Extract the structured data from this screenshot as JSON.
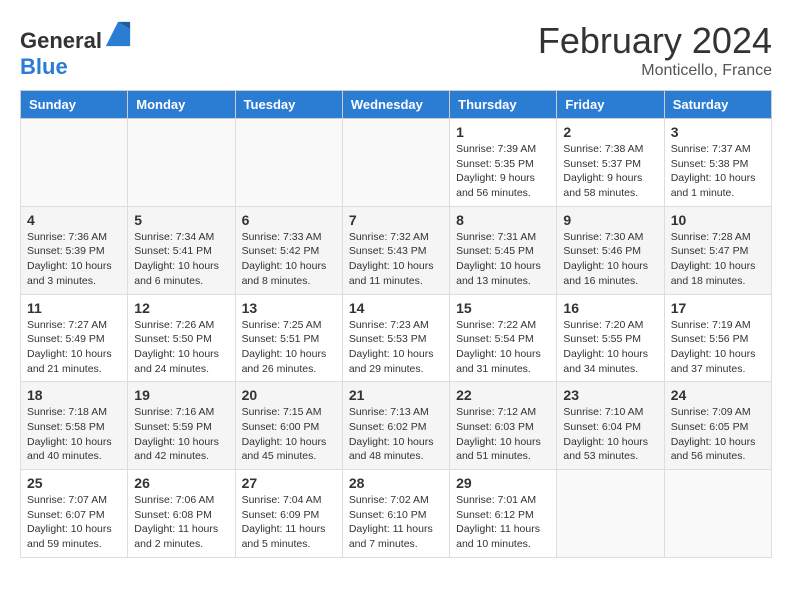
{
  "header": {
    "logo_general": "General",
    "logo_blue": "Blue",
    "title": "February 2024",
    "subtitle": "Monticello, France"
  },
  "days_of_week": [
    "Sunday",
    "Monday",
    "Tuesday",
    "Wednesday",
    "Thursday",
    "Friday",
    "Saturday"
  ],
  "weeks": [
    [
      {
        "day": "",
        "info": ""
      },
      {
        "day": "",
        "info": ""
      },
      {
        "day": "",
        "info": ""
      },
      {
        "day": "",
        "info": ""
      },
      {
        "day": "1",
        "info": "Sunrise: 7:39 AM\nSunset: 5:35 PM\nDaylight: 9 hours\nand 56 minutes."
      },
      {
        "day": "2",
        "info": "Sunrise: 7:38 AM\nSunset: 5:37 PM\nDaylight: 9 hours\nand 58 minutes."
      },
      {
        "day": "3",
        "info": "Sunrise: 7:37 AM\nSunset: 5:38 PM\nDaylight: 10 hours\nand 1 minute."
      }
    ],
    [
      {
        "day": "4",
        "info": "Sunrise: 7:36 AM\nSunset: 5:39 PM\nDaylight: 10 hours\nand 3 minutes."
      },
      {
        "day": "5",
        "info": "Sunrise: 7:34 AM\nSunset: 5:41 PM\nDaylight: 10 hours\nand 6 minutes."
      },
      {
        "day": "6",
        "info": "Sunrise: 7:33 AM\nSunset: 5:42 PM\nDaylight: 10 hours\nand 8 minutes."
      },
      {
        "day": "7",
        "info": "Sunrise: 7:32 AM\nSunset: 5:43 PM\nDaylight: 10 hours\nand 11 minutes."
      },
      {
        "day": "8",
        "info": "Sunrise: 7:31 AM\nSunset: 5:45 PM\nDaylight: 10 hours\nand 13 minutes."
      },
      {
        "day": "9",
        "info": "Sunrise: 7:30 AM\nSunset: 5:46 PM\nDaylight: 10 hours\nand 16 minutes."
      },
      {
        "day": "10",
        "info": "Sunrise: 7:28 AM\nSunset: 5:47 PM\nDaylight: 10 hours\nand 18 minutes."
      }
    ],
    [
      {
        "day": "11",
        "info": "Sunrise: 7:27 AM\nSunset: 5:49 PM\nDaylight: 10 hours\nand 21 minutes."
      },
      {
        "day": "12",
        "info": "Sunrise: 7:26 AM\nSunset: 5:50 PM\nDaylight: 10 hours\nand 24 minutes."
      },
      {
        "day": "13",
        "info": "Sunrise: 7:25 AM\nSunset: 5:51 PM\nDaylight: 10 hours\nand 26 minutes."
      },
      {
        "day": "14",
        "info": "Sunrise: 7:23 AM\nSunset: 5:53 PM\nDaylight: 10 hours\nand 29 minutes."
      },
      {
        "day": "15",
        "info": "Sunrise: 7:22 AM\nSunset: 5:54 PM\nDaylight: 10 hours\nand 31 minutes."
      },
      {
        "day": "16",
        "info": "Sunrise: 7:20 AM\nSunset: 5:55 PM\nDaylight: 10 hours\nand 34 minutes."
      },
      {
        "day": "17",
        "info": "Sunrise: 7:19 AM\nSunset: 5:56 PM\nDaylight: 10 hours\nand 37 minutes."
      }
    ],
    [
      {
        "day": "18",
        "info": "Sunrise: 7:18 AM\nSunset: 5:58 PM\nDaylight: 10 hours\nand 40 minutes."
      },
      {
        "day": "19",
        "info": "Sunrise: 7:16 AM\nSunset: 5:59 PM\nDaylight: 10 hours\nand 42 minutes."
      },
      {
        "day": "20",
        "info": "Sunrise: 7:15 AM\nSunset: 6:00 PM\nDaylight: 10 hours\nand 45 minutes."
      },
      {
        "day": "21",
        "info": "Sunrise: 7:13 AM\nSunset: 6:02 PM\nDaylight: 10 hours\nand 48 minutes."
      },
      {
        "day": "22",
        "info": "Sunrise: 7:12 AM\nSunset: 6:03 PM\nDaylight: 10 hours\nand 51 minutes."
      },
      {
        "day": "23",
        "info": "Sunrise: 7:10 AM\nSunset: 6:04 PM\nDaylight: 10 hours\nand 53 minutes."
      },
      {
        "day": "24",
        "info": "Sunrise: 7:09 AM\nSunset: 6:05 PM\nDaylight: 10 hours\nand 56 minutes."
      }
    ],
    [
      {
        "day": "25",
        "info": "Sunrise: 7:07 AM\nSunset: 6:07 PM\nDaylight: 10 hours\nand 59 minutes."
      },
      {
        "day": "26",
        "info": "Sunrise: 7:06 AM\nSunset: 6:08 PM\nDaylight: 11 hours\nand 2 minutes."
      },
      {
        "day": "27",
        "info": "Sunrise: 7:04 AM\nSunset: 6:09 PM\nDaylight: 11 hours\nand 5 minutes."
      },
      {
        "day": "28",
        "info": "Sunrise: 7:02 AM\nSunset: 6:10 PM\nDaylight: 11 hours\nand 7 minutes."
      },
      {
        "day": "29",
        "info": "Sunrise: 7:01 AM\nSunset: 6:12 PM\nDaylight: 11 hours\nand 10 minutes."
      },
      {
        "day": "",
        "info": ""
      },
      {
        "day": "",
        "info": ""
      }
    ]
  ]
}
